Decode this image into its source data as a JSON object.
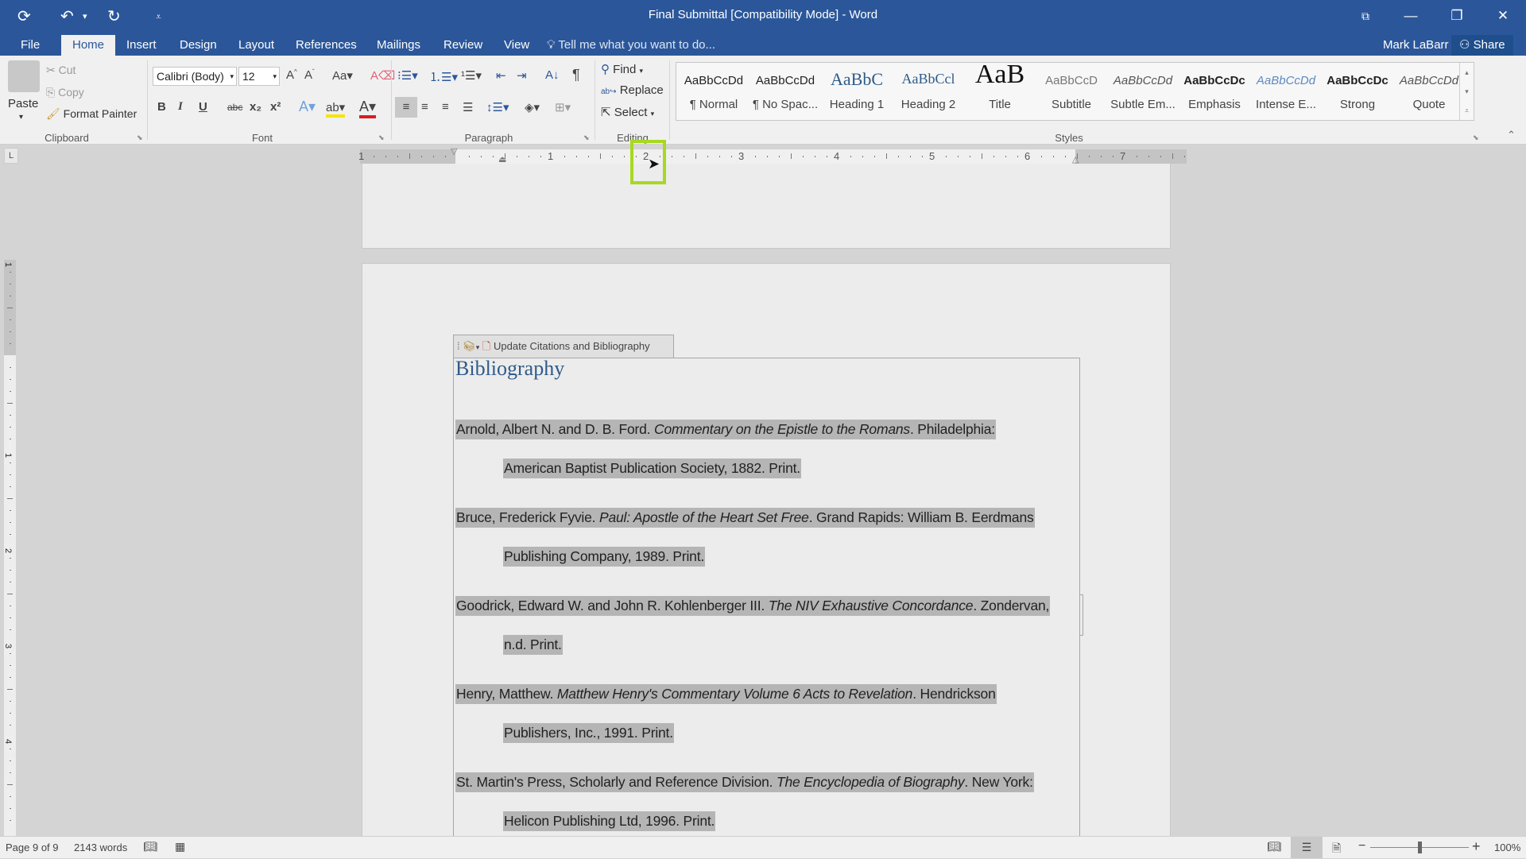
{
  "window": {
    "title": "Final Submittal [Compatibility Mode] - Word",
    "user": "Mark LaBarr",
    "share_label": "Share",
    "controls": [
      "ribbon-display-options",
      "minimize",
      "restore",
      "close"
    ]
  },
  "qat": {
    "save_icon": "autosave-icon",
    "undo_icon": "undo-icon",
    "redo_icon": "redo-icon",
    "customize_icon": "customize-qat-icon"
  },
  "tabs": [
    {
      "label": "File",
      "active": false
    },
    {
      "label": "Home",
      "active": true
    },
    {
      "label": "Insert",
      "active": false
    },
    {
      "label": "Design",
      "active": false
    },
    {
      "label": "Layout",
      "active": false
    },
    {
      "label": "References",
      "active": false
    },
    {
      "label": "Mailings",
      "active": false
    },
    {
      "label": "Review",
      "active": false
    },
    {
      "label": "View",
      "active": false
    }
  ],
  "tell_me": {
    "placeholder": "Tell me what you want to do..."
  },
  "ribbon": {
    "clipboard": {
      "label": "Clipboard",
      "paste": "Paste",
      "cut": "Cut",
      "copy": "Copy",
      "format_painter": "Format Painter"
    },
    "font": {
      "label": "Font",
      "font_name": "Calibri (Body)",
      "font_size": "12",
      "bold": "B",
      "italic": "I",
      "underline": "U",
      "strike": "abc",
      "subscript": "x₂",
      "superscript": "x²",
      "grow": "A˄",
      "shrink": "A˅",
      "change_case": "Aa"
    },
    "paragraph": {
      "label": "Paragraph"
    },
    "editing": {
      "label": "Editing",
      "find": "Find",
      "replace": "Replace",
      "select": "Select"
    },
    "styles": {
      "label": "Styles",
      "items": [
        {
          "sample": "AaBbCcDd",
          "name": "¶ Normal"
        },
        {
          "sample": "AaBbCcDd",
          "name": "¶ No Spac..."
        },
        {
          "sample": "AaBbC",
          "name": "Heading 1"
        },
        {
          "sample": "AaBbCcl",
          "name": "Heading 2"
        },
        {
          "sample": "AaB",
          "name": "Title"
        },
        {
          "sample": "AaBbCcD",
          "name": "Subtitle"
        },
        {
          "sample": "AaBbCcDd",
          "name": "Subtle Em..."
        },
        {
          "sample": "AaBbCcDc",
          "name": "Emphasis"
        },
        {
          "sample": "AaBbCcDd",
          "name": "Intense E..."
        },
        {
          "sample": "AaBbCcDc",
          "name": "Strong"
        },
        {
          "sample": "AaBbCcDd",
          "name": "Quote"
        }
      ]
    }
  },
  "ruler": {
    "numbers": [
      "1",
      "1",
      "2",
      "3",
      "4",
      "5",
      "6",
      "7"
    ],
    "tab_selector": "L"
  },
  "vruler": {
    "numbers": [
      "1",
      "1",
      "2",
      "3",
      "4"
    ]
  },
  "document": {
    "bib_toolbar_label": "Update Citations and Bibliography",
    "heading": "Bibliography",
    "entries": [
      {
        "line1_pre": "Arnold, Albert N. and D. B. Ford. ",
        "line1_title": "Commentary on the Epistle to the Romans",
        "line1_post": ". Philadelphia:",
        "line2": "American Baptist Publication Society, 1882. Print."
      },
      {
        "line1_pre": "Bruce, Frederick Fyvie. ",
        "line1_title": "Paul: Apostle of the Heart Set Free",
        "line1_post": ". Grand Rapids: William B. Eerdmans",
        "line2": "Publishing Company, 1989. Print."
      },
      {
        "line1_pre": "Goodrick, Edward W. and John R. Kohlenberger III. ",
        "line1_title": "The NIV Exhaustive Concordance",
        "line1_post": ". Zondervan,",
        "line2": "n.d. Print."
      },
      {
        "line1_pre": "Henry, Matthew. ",
        "line1_title": "Matthew Henry's Commentary Volume 6 Acts to Revelation",
        "line1_post": ". Hendrickson",
        "line2": "Publishers, Inc., 1991. Print."
      },
      {
        "line1_pre": "St. Martin's Press, Scholarly and Reference Division. ",
        "line1_title": "The Encyclopedia of Biography",
        "line1_post": ". New York:",
        "line2": "Helicon Publishing Ltd, 1996. Print."
      }
    ]
  },
  "status": {
    "page": "Page 9 of 9",
    "words": "2143 words",
    "zoom": "100%",
    "zoom_minus": "−",
    "zoom_plus": "+",
    "zoom_level_percent": 100
  },
  "colors": {
    "accent": "#2b579a",
    "highlight": "#a8d820",
    "field_shading": "#b5b5b5",
    "heading": "#2e5b8a"
  }
}
